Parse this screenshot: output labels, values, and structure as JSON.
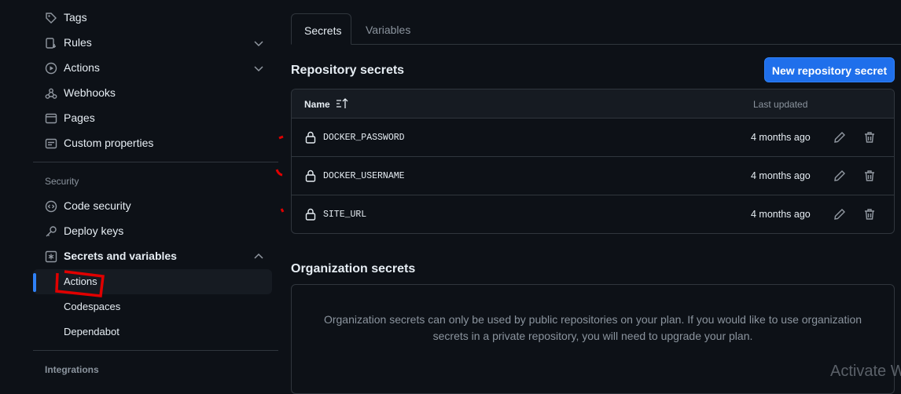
{
  "sidebar": {
    "items": [
      {
        "label": "Tags",
        "icon": "tag-icon"
      },
      {
        "label": "Rules",
        "icon": "rules-icon"
      },
      {
        "label": "Actions",
        "icon": "play-icon"
      },
      {
        "label": "Webhooks",
        "icon": "webhook-icon"
      },
      {
        "label": "Pages",
        "icon": "browser-icon"
      },
      {
        "label": "Custom properties",
        "icon": "note-icon"
      }
    ],
    "security_heading": "Security",
    "security_items": [
      {
        "label": "Code security",
        "icon": "codescan-icon"
      },
      {
        "label": "Deploy keys",
        "icon": "key-icon"
      },
      {
        "label": "Secrets and variables",
        "icon": "asterisk-icon"
      }
    ],
    "sub_items": [
      {
        "label": "Actions",
        "active": true
      },
      {
        "label": "Codespaces"
      },
      {
        "label": "Dependabot"
      }
    ],
    "integrations_heading": "Integrations"
  },
  "tabs": [
    {
      "label": "Secrets",
      "active": true
    },
    {
      "label": "Variables"
    }
  ],
  "repo_secrets": {
    "heading": "Repository secrets",
    "new_button": "New repository secret",
    "columns": {
      "name": "Name",
      "updated": "Last updated"
    },
    "rows": [
      {
        "name": "DOCKER_PASSWORD",
        "updated": "4 months ago"
      },
      {
        "name": "DOCKER_USERNAME",
        "updated": "4 months ago"
      },
      {
        "name": "SITE_URL",
        "updated": "4 months ago"
      }
    ]
  },
  "org_secrets": {
    "heading": "Organization secrets",
    "message": "Organization secrets can only be used by public repositories on your plan. If you would like to use organization secrets in a private repository, you will need to upgrade your plan."
  },
  "watermark": "Activate W",
  "colors": {
    "accent": "#2f81f7",
    "button": "#1f6feb",
    "annotation": "#e00000"
  }
}
